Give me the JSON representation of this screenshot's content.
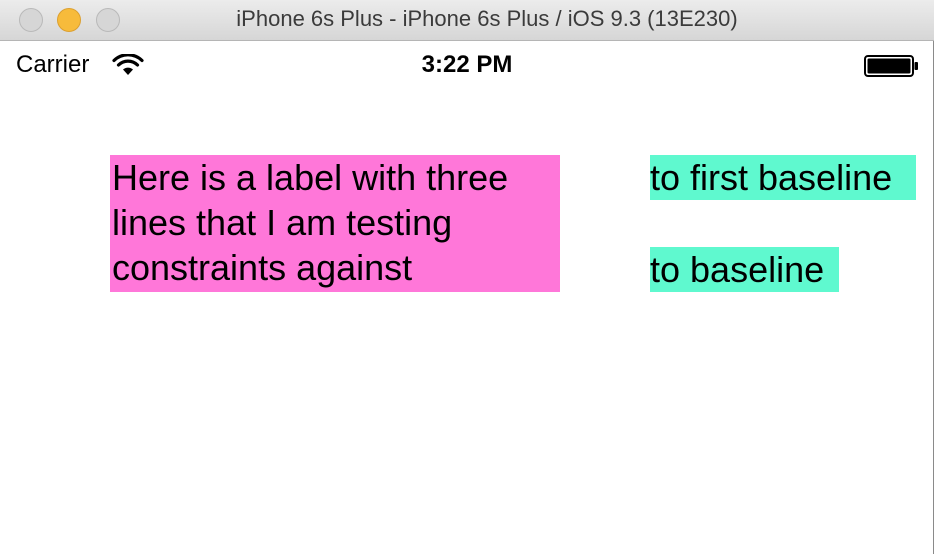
{
  "window": {
    "title": "iPhone 6s Plus - iPhone 6s Plus / iOS 9.3 (13E230)",
    "buttons": [
      "close",
      "minimize",
      "zoom"
    ]
  },
  "status_bar": {
    "carrier": "Carrier",
    "time": "3:22 PM",
    "wifi_icon": "wifi-icon",
    "battery_icon": "battery-icon"
  },
  "content": {
    "multiline_label": "Here is a label with three\nlines that I am testing\nconstraints against",
    "first_baseline_label": "to first baseline",
    "baseline_label": "to baseline"
  },
  "colors": {
    "pink_label_bg": "#ff77d9",
    "green_label_bg": "#5ff9cf",
    "minimize_button": "#f7bb3b"
  }
}
